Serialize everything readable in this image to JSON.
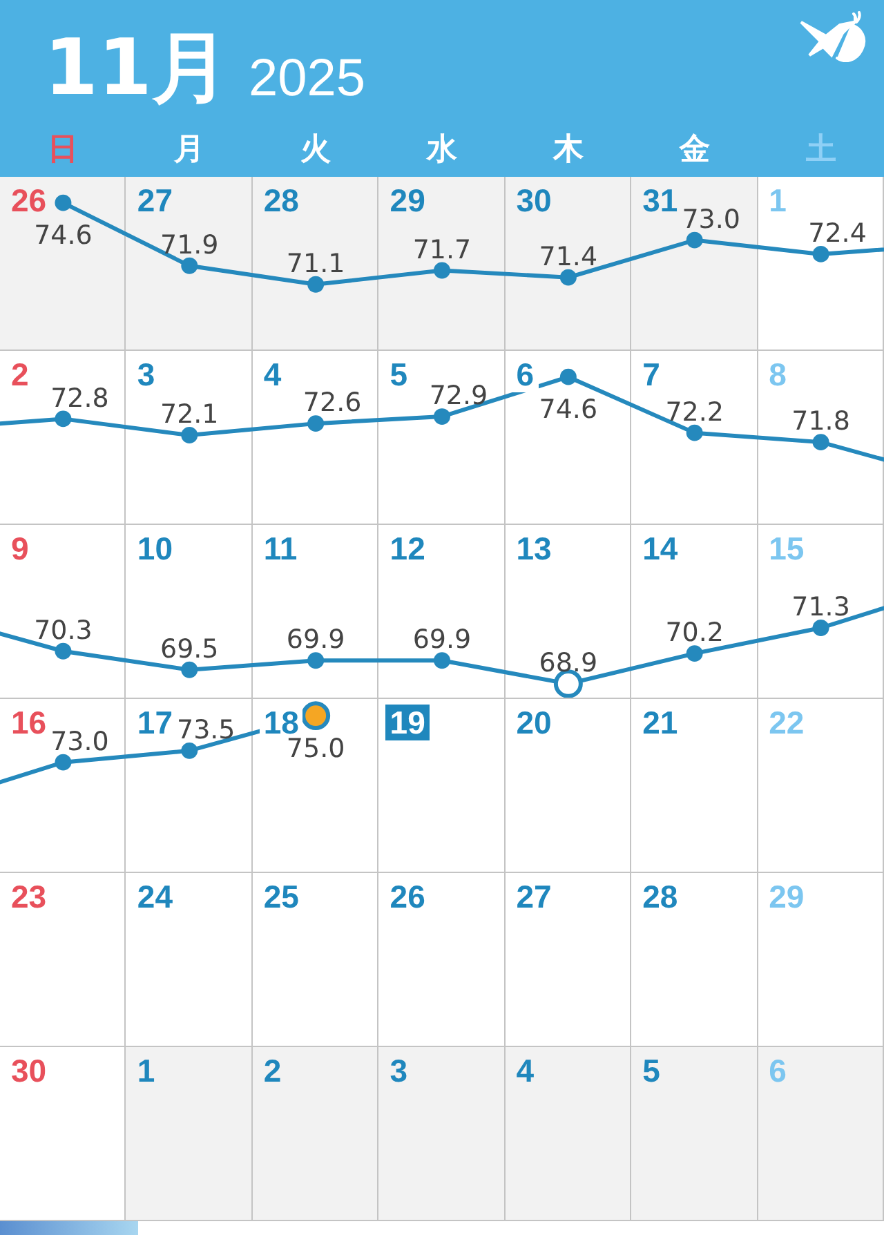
{
  "header": {
    "month": "11月",
    "year": "2025"
  },
  "weekdays": [
    "日",
    "月",
    "火",
    "水",
    "木",
    "金",
    "土"
  ],
  "weeks": [
    {
      "days": [
        {
          "date": "26",
          "in_month": false,
          "weight": "74.6",
          "hollow": false,
          "highlighted": false
        },
        {
          "date": "27",
          "in_month": false,
          "weight": "71.9",
          "hollow": false,
          "highlighted": false
        },
        {
          "date": "28",
          "in_month": false,
          "weight": "71.1",
          "hollow": false,
          "highlighted": false
        },
        {
          "date": "29",
          "in_month": false,
          "weight": "71.7",
          "hollow": false,
          "highlighted": false
        },
        {
          "date": "30",
          "in_month": false,
          "weight": "71.4",
          "hollow": false,
          "highlighted": false
        },
        {
          "date": "31",
          "in_month": false,
          "weight": "73.0",
          "hollow": false,
          "highlighted": false
        },
        {
          "date": "1",
          "in_month": true,
          "weight": "72.4",
          "hollow": false,
          "highlighted": false
        }
      ]
    },
    {
      "days": [
        {
          "date": "2",
          "in_month": true,
          "weight": "72.8",
          "hollow": false,
          "highlighted": false
        },
        {
          "date": "3",
          "in_month": true,
          "weight": "72.1",
          "hollow": false,
          "highlighted": false
        },
        {
          "date": "4",
          "in_month": true,
          "weight": "72.6",
          "hollow": false,
          "highlighted": false
        },
        {
          "date": "5",
          "in_month": true,
          "weight": "72.9",
          "hollow": false,
          "highlighted": false
        },
        {
          "date": "6",
          "in_month": true,
          "weight": "74.6",
          "hollow": false,
          "highlighted": false
        },
        {
          "date": "7",
          "in_month": true,
          "weight": "72.2",
          "hollow": false,
          "highlighted": false
        },
        {
          "date": "8",
          "in_month": true,
          "weight": "71.8",
          "hollow": false,
          "highlighted": false
        }
      ]
    },
    {
      "days": [
        {
          "date": "9",
          "in_month": true,
          "weight": "70.3",
          "hollow": false,
          "highlighted": false
        },
        {
          "date": "10",
          "in_month": true,
          "weight": "69.5",
          "hollow": false,
          "highlighted": false
        },
        {
          "date": "11",
          "in_month": true,
          "weight": "69.9",
          "hollow": false,
          "highlighted": false
        },
        {
          "date": "12",
          "in_month": true,
          "weight": "69.9",
          "hollow": false,
          "highlighted": false
        },
        {
          "date": "13",
          "in_month": true,
          "weight": "68.9",
          "hollow": true,
          "highlighted": false
        },
        {
          "date": "14",
          "in_month": true,
          "weight": "70.2",
          "hollow": false,
          "highlighted": false
        },
        {
          "date": "15",
          "in_month": true,
          "weight": "71.3",
          "hollow": false,
          "highlighted": false
        }
      ]
    },
    {
      "days": [
        {
          "date": "16",
          "in_month": true,
          "weight": "73.0",
          "hollow": false,
          "highlighted": false
        },
        {
          "date": "17",
          "in_month": true,
          "weight": "73.5",
          "hollow": false,
          "highlighted": false
        },
        {
          "date": "18",
          "in_month": true,
          "weight": "75.0",
          "hollow": true,
          "highlighted": true
        },
        {
          "date": "19",
          "in_month": true,
          "today": true
        },
        {
          "date": "20",
          "in_month": true
        },
        {
          "date": "21",
          "in_month": true
        },
        {
          "date": "22",
          "in_month": true
        }
      ]
    },
    {
      "days": [
        {
          "date": "23",
          "in_month": true
        },
        {
          "date": "24",
          "in_month": true
        },
        {
          "date": "25",
          "in_month": true
        },
        {
          "date": "26",
          "in_month": true
        },
        {
          "date": "27",
          "in_month": true
        },
        {
          "date": "28",
          "in_month": true
        },
        {
          "date": "29",
          "in_month": true
        }
      ]
    },
    {
      "days": [
        {
          "date": "30",
          "in_month": true
        },
        {
          "date": "1",
          "in_month": false
        },
        {
          "date": "2",
          "in_month": false
        },
        {
          "date": "3",
          "in_month": false
        },
        {
          "date": "4",
          "in_month": false
        },
        {
          "date": "5",
          "in_month": false
        },
        {
          "date": "6",
          "in_month": false
        }
      ]
    }
  ]
}
